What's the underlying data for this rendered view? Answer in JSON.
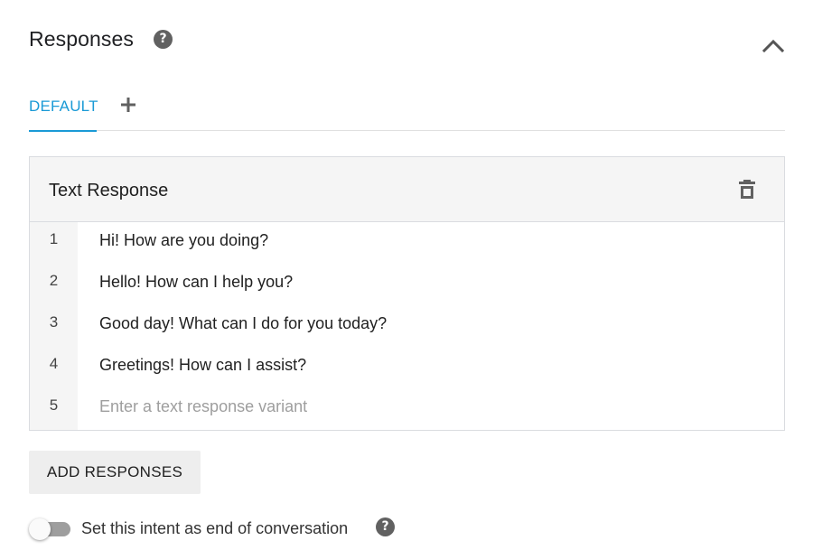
{
  "section": {
    "title": "Responses",
    "icons": {
      "help": "help-circle-icon",
      "collapse": "chevron-up-icon"
    }
  },
  "tabs": {
    "items": [
      {
        "label": "DEFAULT",
        "active": true
      }
    ],
    "add_icon": "plus-icon"
  },
  "text_response": {
    "title": "Text Response",
    "delete_icon": "trash-icon",
    "rows": [
      {
        "number": "1",
        "value": "Hi! How are you doing?"
      },
      {
        "number": "2",
        "value": "Hello! How can I help you?"
      },
      {
        "number": "3",
        "value": "Good day! What can I do for you today?"
      },
      {
        "number": "4",
        "value": "Greetings! How can I assist?"
      },
      {
        "number": "5",
        "value": "",
        "placeholder": "Enter a text response variant"
      }
    ]
  },
  "add_responses_label": "ADD RESPONSES",
  "end_conversation": {
    "label": "Set this intent as end of conversation",
    "enabled": false
  },
  "colors": {
    "accent": "#1a9ad6",
    "icon_gray": "#616161",
    "panel_bg": "#f5f5f5",
    "button_bg": "#eeeeee"
  }
}
